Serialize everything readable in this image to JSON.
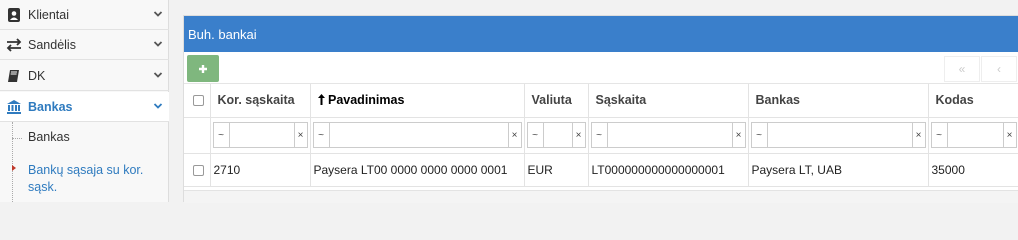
{
  "sidebar": {
    "items": [
      {
        "label": "Klientai",
        "icon": "user-card-icon"
      },
      {
        "label": "Sandėlis",
        "icon": "arrows-exchange-icon"
      },
      {
        "label": "DK",
        "icon": "book-icon"
      },
      {
        "label": "Bankas",
        "icon": "bank-icon",
        "active": true
      }
    ],
    "subitems": [
      {
        "label": "Bankas"
      },
      {
        "label_line1": "Bankų sąsaja su kor.",
        "label_line2": "sąsk.",
        "current": true
      }
    ]
  },
  "panel": {
    "title": "Buh. bankai",
    "add_label": "+",
    "pager_first": "«",
    "pager_prev": "‹"
  },
  "table": {
    "columns": [
      {
        "label": "Kor. sąskaita"
      },
      {
        "label": "Pavadinimas",
        "sort_indicator": "🠕",
        "sorted": true
      },
      {
        "label": "Valiuta"
      },
      {
        "label": "Sąskaita"
      },
      {
        "label": "Bankas"
      },
      {
        "label": "Kodas"
      }
    ],
    "filter_op": "~",
    "filter_clear": "×",
    "rows": [
      {
        "kor": "2710",
        "pavadinimas": "Paysera LT00 0000 0000 0000 0001",
        "valiuta": "EUR",
        "saskaita": "LT000000000000000001",
        "bankas": "Paysera LT, UAB",
        "kodas": "35000"
      }
    ]
  },
  "colors": {
    "header_blue": "#3a7fcb",
    "add_green": "#7fb77e",
    "link_blue": "#2f7bbf",
    "caret_red": "#c0392b"
  }
}
